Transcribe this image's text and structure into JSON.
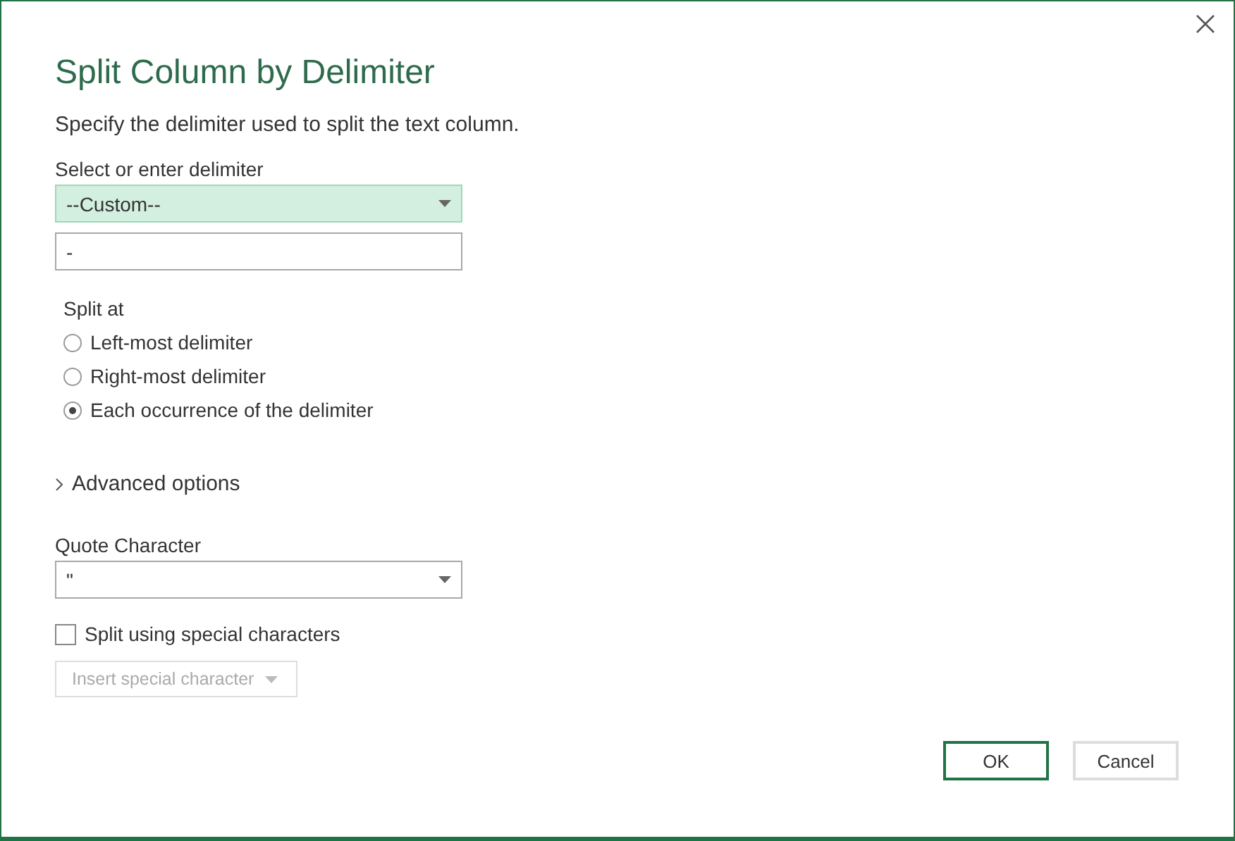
{
  "dialog": {
    "title": "Split Column by Delimiter",
    "description": "Specify the delimiter used to split the text column."
  },
  "delimiter": {
    "label": "Select or enter delimiter",
    "selected_option": "--Custom--",
    "value": "-"
  },
  "split_at": {
    "label": "Split at",
    "options": [
      {
        "label": "Left-most delimiter",
        "selected": false
      },
      {
        "label": "Right-most delimiter",
        "selected": false
      },
      {
        "label": "Each occurrence of the delimiter",
        "selected": true
      }
    ]
  },
  "advanced_options": {
    "label": "Advanced options",
    "expanded": false
  },
  "quote_character": {
    "label": "Quote Character",
    "value": "\""
  },
  "special_characters": {
    "label": "Split using special characters",
    "checked": false
  },
  "insert_special": {
    "label": "Insert special character",
    "disabled": true
  },
  "buttons": [
    {
      "label": "OK",
      "kind": "primary"
    },
    {
      "label": "Cancel",
      "kind": "secondary"
    }
  ]
}
